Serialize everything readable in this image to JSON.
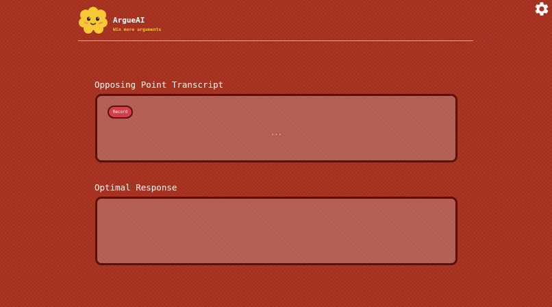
{
  "app": {
    "name": "ArgueAI",
    "tagline": "Win more arguments"
  },
  "icons": {
    "logo": "smiling-cloud-mascot-icon",
    "settings": "gear-icon"
  },
  "colors": {
    "background": "#a8321f",
    "panel": "#b25e52",
    "panel_border": "#5a0f0a",
    "tagline": "#f5c33a",
    "record_button": "#d43d4c",
    "logo": "#f7c935"
  },
  "transcript": {
    "title": "Opposing Point Transcript",
    "record_label": "Record",
    "text": "..."
  },
  "response": {
    "title": "Optimal Response",
    "text": ""
  }
}
